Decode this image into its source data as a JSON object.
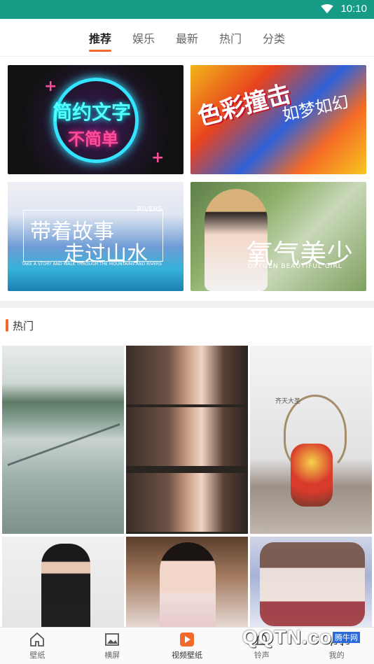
{
  "status_bar": {
    "time": "10:10",
    "icons": [
      "wifi-icon"
    ]
  },
  "top_tabs": {
    "items": [
      {
        "label": "推荐",
        "active": true
      },
      {
        "label": "娱乐",
        "active": false
      },
      {
        "label": "最新",
        "active": false
      },
      {
        "label": "热门",
        "active": false
      },
      {
        "label": "分类",
        "active": false
      }
    ]
  },
  "banners": [
    {
      "line1": "简约文字",
      "line2": "不简单"
    },
    {
      "line1": "色彩撞击",
      "line2": "如梦如幻"
    },
    {
      "line1": "带着故事",
      "line2": "走过山水",
      "caption": "TAKE A STORY AND WALK THROUGH THE MOUNTAINS AND RIVERS",
      "corner": "RIVERS"
    },
    {
      "line1": "氧气美少",
      "line2": "OXYGEN BEAUTIFUL GIRL"
    }
  ],
  "section": {
    "title": "热门"
  },
  "hot_images": [
    {
      "caption": ""
    },
    {
      "caption": ""
    },
    {
      "caption": "齐天大圣"
    }
  ],
  "bottom_nav": {
    "items": [
      {
        "label": "壁纸",
        "icon": "home-icon",
        "active": false
      },
      {
        "label": "横屏",
        "icon": "image-icon",
        "active": false
      },
      {
        "label": "视频壁纸",
        "icon": "video-play-icon",
        "active": true
      },
      {
        "label": "铃声",
        "icon": "bell-icon",
        "active": false
      },
      {
        "label": "我的",
        "icon": "user-icon",
        "active": false
      }
    ]
  },
  "watermark": {
    "logo": "QQTN.com",
    "site": "腾牛网"
  },
  "colors": {
    "status_bar": "#169b87",
    "accent": "#f26a2b",
    "video_icon": "#f26a2b"
  }
}
